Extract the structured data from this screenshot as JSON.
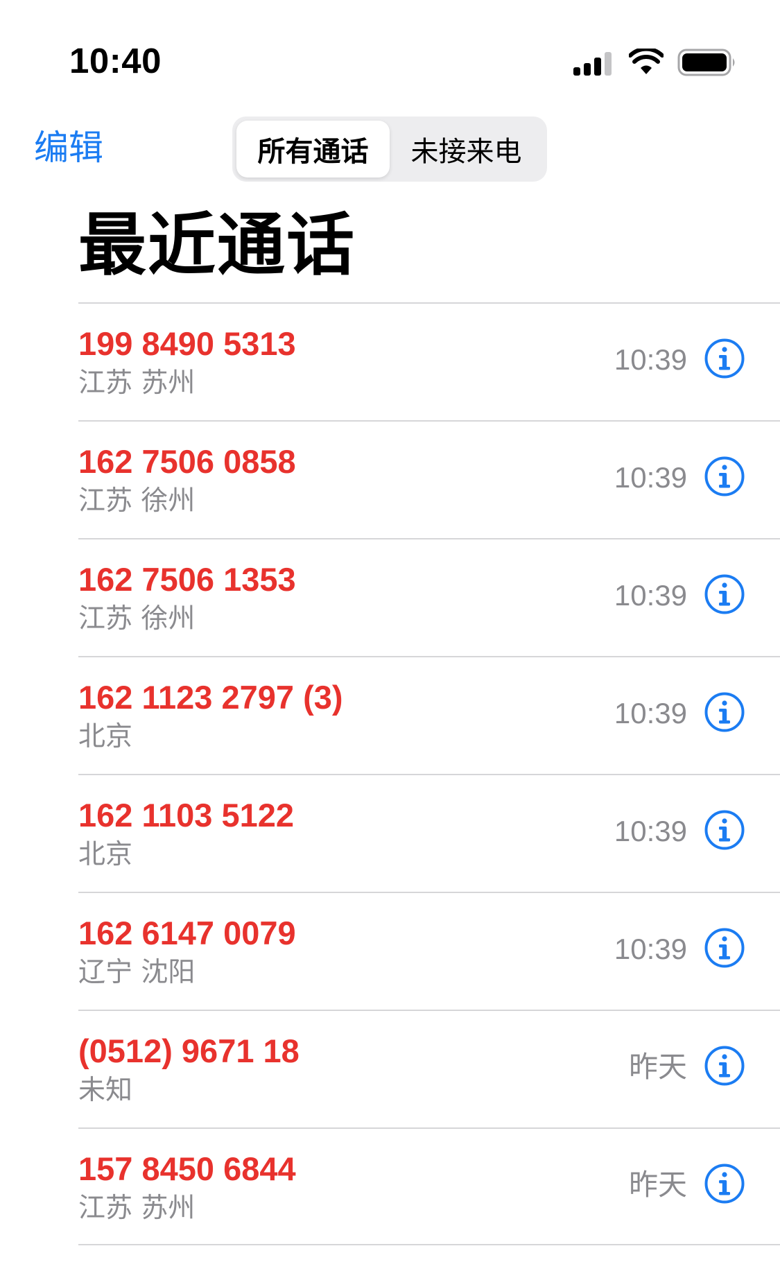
{
  "status_bar": {
    "time": "10:40",
    "icons": [
      "cellular-signal-icon",
      "wifi-icon",
      "battery-icon"
    ]
  },
  "nav": {
    "edit_label": "编辑",
    "segments": [
      "所有通话",
      "未接来电"
    ],
    "selected_segment": "所有通话"
  },
  "title": "最近通话",
  "colors": {
    "accent": "#1b7cf2",
    "missed_call": "#e8322d",
    "secondary_text": "#8a8a8e"
  },
  "calls": [
    {
      "number": "199 8490 5313",
      "location": "江苏 苏州",
      "time": "10:39"
    },
    {
      "number": "162 7506 0858",
      "location": "江苏 徐州",
      "time": "10:39"
    },
    {
      "number": "162 7506 1353",
      "location": "江苏 徐州",
      "time": "10:39"
    },
    {
      "number": "162 1123 2797 (3)",
      "location": "北京",
      "time": "10:39"
    },
    {
      "number": "162 1103 5122",
      "location": "北京",
      "time": "10:39"
    },
    {
      "number": "162 6147 0079",
      "location": "辽宁 沈阳",
      "time": "10:39"
    },
    {
      "number": "(0512) 9671 18",
      "location": "未知",
      "time": "昨天"
    },
    {
      "number": "157 8450 6844",
      "location": "江苏 苏州",
      "time": "昨天"
    }
  ]
}
